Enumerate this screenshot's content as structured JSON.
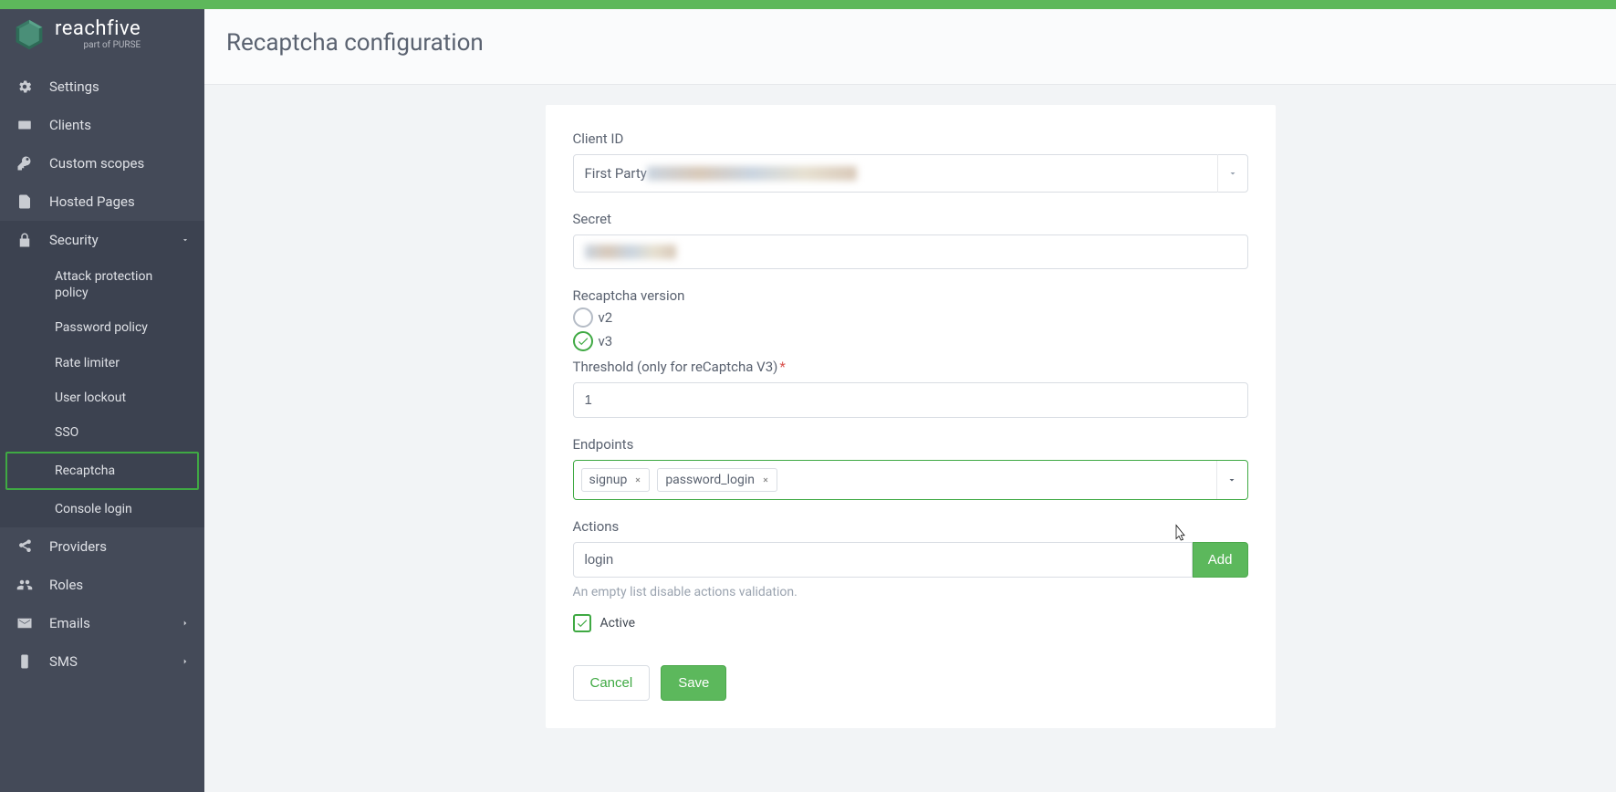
{
  "brand": {
    "name": "reachfive",
    "sub": "part of PURSE"
  },
  "sidebar": {
    "items": [
      {
        "label": "Settings"
      },
      {
        "label": "Clients"
      },
      {
        "label": "Custom scopes"
      },
      {
        "label": "Hosted Pages"
      },
      {
        "label": "Security"
      },
      {
        "label": "Providers"
      },
      {
        "label": "Roles"
      },
      {
        "label": "Emails"
      },
      {
        "label": "SMS"
      }
    ],
    "security_sub": [
      {
        "label": "Attack protection policy"
      },
      {
        "label": "Password policy"
      },
      {
        "label": "Rate limiter"
      },
      {
        "label": "User lockout"
      },
      {
        "label": "SSO"
      },
      {
        "label": "Recaptcha"
      },
      {
        "label": "Console login"
      }
    ]
  },
  "header": {
    "title": "Recaptcha configuration"
  },
  "form": {
    "client_id_label": "Client ID",
    "client_id_prefix": "First Party ",
    "secret_label": "Secret",
    "version_label": "Recaptcha version",
    "version_v2": "v2",
    "version_v3": "v3",
    "threshold_label": "Threshold (only for reCaptcha V3)",
    "threshold_value": "1",
    "endpoints_label": "Endpoints",
    "endpoints": [
      {
        "label": "signup"
      },
      {
        "label": "password_login"
      }
    ],
    "actions_label": "Actions",
    "action_input": "login",
    "add_label": "Add",
    "actions_help": "An empty list disable actions validation.",
    "active_label": "Active",
    "cancel_label": "Cancel",
    "save_label": "Save"
  }
}
